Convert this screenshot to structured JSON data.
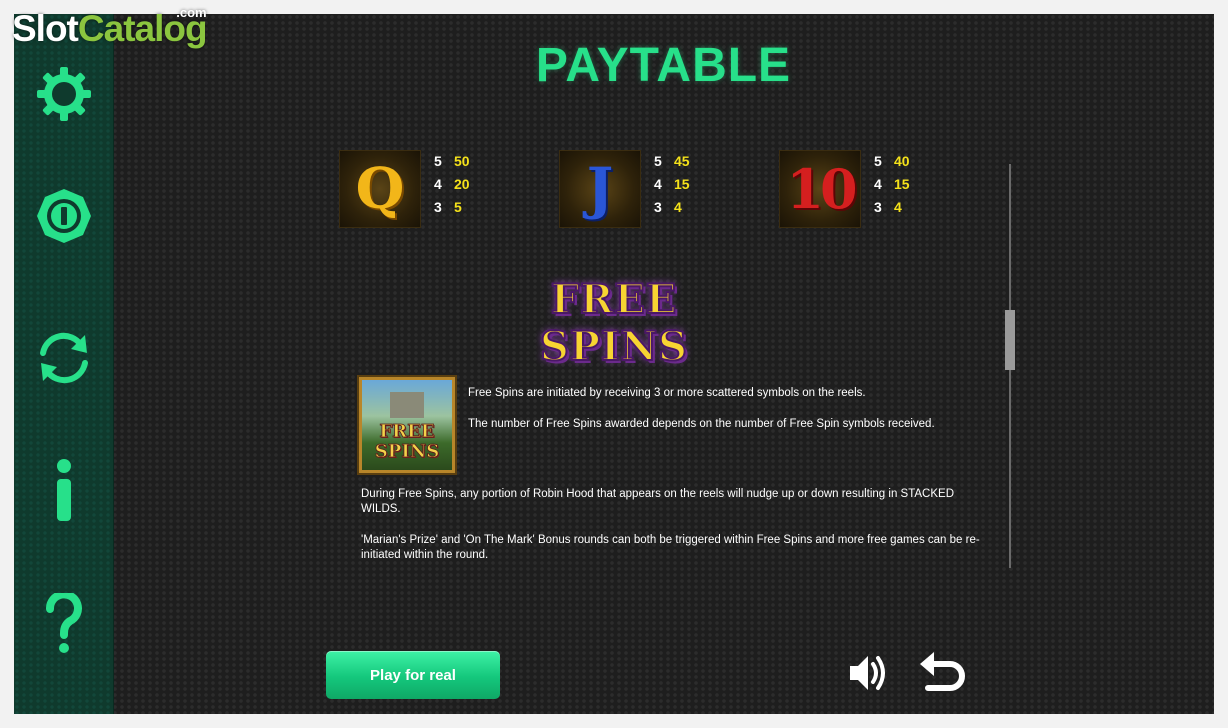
{
  "brand": {
    "part1": "Slot",
    "part2": "Catalog",
    "suffix": ".com"
  },
  "title": "PAYTABLE",
  "sidebar": {
    "items": [
      {
        "name": "settings",
        "icon": "gear-icon"
      },
      {
        "name": "bet",
        "icon": "coin-icon"
      },
      {
        "name": "autoplay",
        "icon": "refresh-icon"
      },
      {
        "name": "info",
        "icon": "info-icon"
      },
      {
        "name": "help",
        "icon": "question-icon"
      }
    ],
    "accent": "#27e08a"
  },
  "symbols": [
    {
      "glyph": "Q",
      "color": "#f2b619",
      "pays": [
        {
          "count": "5",
          "value": "50"
        },
        {
          "count": "4",
          "value": "20"
        },
        {
          "count": "3",
          "value": "5"
        }
      ]
    },
    {
      "glyph": "J",
      "color": "#2a56d6",
      "pays": [
        {
          "count": "5",
          "value": "45"
        },
        {
          "count": "4",
          "value": "15"
        },
        {
          "count": "3",
          "value": "4"
        }
      ]
    },
    {
      "glyph": "10",
      "color": "#d51f1f",
      "pays": [
        {
          "count": "5",
          "value": "40"
        },
        {
          "count": "4",
          "value": "15"
        },
        {
          "count": "3",
          "value": "4"
        }
      ]
    }
  ],
  "free_spins": {
    "logo_text": "FREE SPINS",
    "icon_text_1": "FREE",
    "icon_text_2": "SPINS",
    "paragraphs": [
      "Free Spins are initiated by receiving 3 or more scattered symbols on the reels.",
      "The number of Free Spins awarded depends on the number of Free Spin symbols received.",
      "During Free Spins, any portion of Robin Hood that appears on the reels will nudge up or down resulting in STACKED WILDS.",
      "'Marian's Prize' and 'On The Mark' Bonus rounds can both be triggered within Free Spins and more free games can be re-initiated within the round."
    ]
  },
  "footer": {
    "play_label": "Play for real",
    "sound_icon": "speaker-icon",
    "back_icon": "back-arrow-icon"
  },
  "colors": {
    "title": "#27e08a",
    "pay_value": "#f5e21a",
    "play_button": "#14c77c"
  }
}
